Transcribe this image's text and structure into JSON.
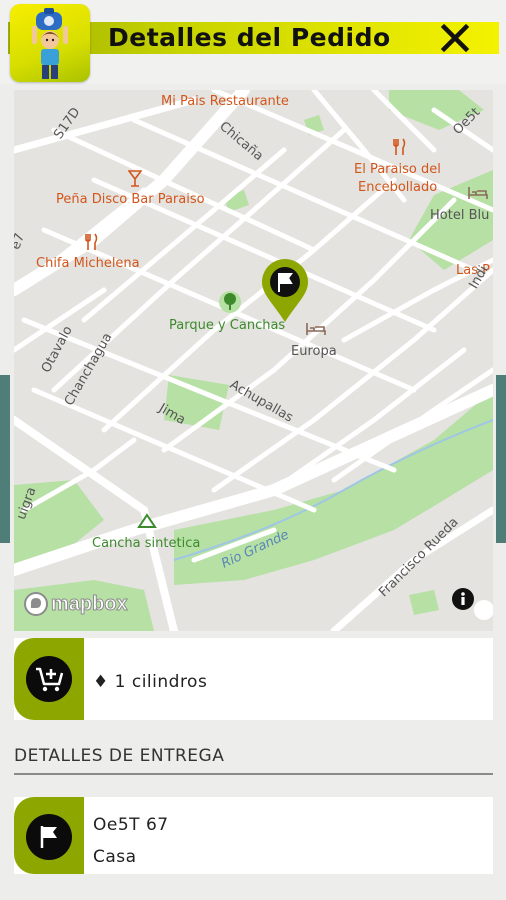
{
  "header": {
    "title": "Detalles del Pedido"
  },
  "map": {
    "attribution": "mapbox",
    "labels": {
      "restaurant1": "Mi Pais Restaurante",
      "bar": "Peña Disco Bar Paraiso",
      "chifa": "Chifa Michelena",
      "park": "Parque y Canchas",
      "europa": "Europa",
      "paraiso1": "El Paraiso del",
      "paraiso2": "Encebollado",
      "hotel": "Hotel Blu",
      "laspe": "Las P",
      "indi": "Indi",
      "cancha": "Cancha sintetica",
      "rio": "Rio Grande",
      "rueda": "Francisco Rueda",
      "achupallas": "Achupallas",
      "jima": "Jima",
      "chanchagua": "Chanchagua",
      "otavalo": "Otavalo",
      "chicana": "Chicaña",
      "s17d": "S17D",
      "oe5t_top": "Oe5t",
      "oe7": "e7",
      "quigra": "uigra"
    }
  },
  "order": {
    "item_text": "♦ 1 cilindros"
  },
  "delivery": {
    "section_title": "DETALLES DE ENTREGA",
    "address_line1": "Oe5T 67",
    "address_line2": "Casa"
  },
  "colors": {
    "accent_green": "#8ea600",
    "header_yellow": "#f4f200"
  }
}
